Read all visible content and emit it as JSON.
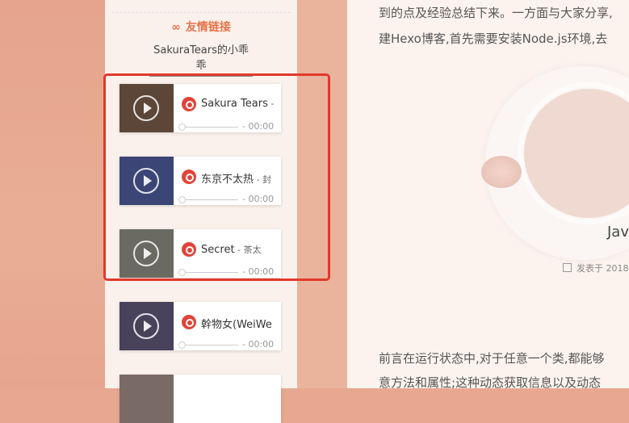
{
  "sidebar": {
    "friend_links_title": "友情链接",
    "friend_links_icon": "link-icon",
    "friend_link": "SakuraTears的小乖乖"
  },
  "music_list": [
    {
      "title": "Sakura Tears",
      "artist": " - ",
      "time": "- 00:00",
      "cover_color": "#5b4638"
    },
    {
      "title": "东京不太热",
      "artist": " - 封",
      "time": "- 00:00",
      "cover_color": "#3b4576"
    },
    {
      "title": "Secret",
      "artist": " - 茶太",
      "time": "- 00:00",
      "cover_color": "#6b6a62"
    },
    {
      "title": "幹物女(WeiWe",
      "artist": "",
      "time": "- 00:00",
      "cover_color": "#48425a"
    }
  ],
  "article": {
    "line1": "到的点及经验总结下来。一方面与大家分享,",
    "line2": "建Hexo博客,首先需要安装Node.js环境,去",
    "post_title": "Jav",
    "post_meta": "发表于 2018",
    "line3": "前言在运行状态中,对于任意一个类,都能够",
    "line4": "意方法和属性;这种动态获取信息以及动态"
  },
  "colors": {
    "accent": "#e6744a",
    "highlight": "#e0392b",
    "netease_red": "#e0443a"
  }
}
